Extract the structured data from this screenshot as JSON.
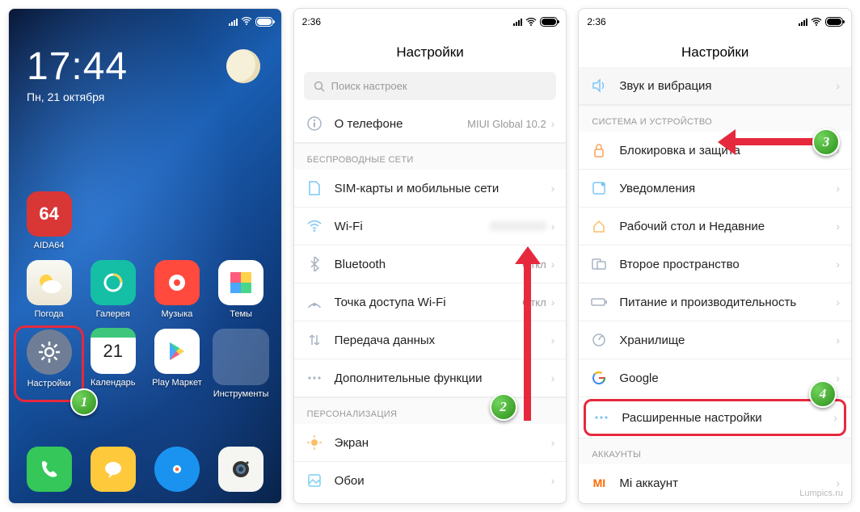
{
  "phone1": {
    "status_time": "",
    "clock_time": "17:44",
    "clock_date": "Пн, 21 октября",
    "apps": [
      {
        "label": "AIDA64",
        "bg": "#d93636",
        "text": "64"
      },
      {
        "label": "",
        "bg": "",
        "text": ""
      },
      {
        "label": "",
        "bg": "",
        "text": ""
      },
      {
        "label": "",
        "bg": "",
        "text": ""
      },
      {
        "label": "Погода",
        "bg": "linear-gradient(180deg,#f7f7f0,#e8e3d0)",
        "icon": "weather"
      },
      {
        "label": "Галерея",
        "bg": "#14bfa6",
        "icon": "gallery"
      },
      {
        "label": "Музыка",
        "bg": "#ff4a3d",
        "icon": "music"
      },
      {
        "label": "Темы",
        "bg": "#fff",
        "icon": "themes"
      },
      {
        "label": "Настройки",
        "bg": "#6f7e96",
        "icon": "gear",
        "highlight": true
      },
      {
        "label": "Календарь",
        "bg": "#fff",
        "text": "21",
        "icon": "calendar"
      },
      {
        "label": "Play Маркет",
        "bg": "#fff",
        "icon": "play"
      },
      {
        "label": "Инструменты",
        "bg": "rgba(255,255,255,0.18)",
        "icon": "folder"
      }
    ],
    "dock": [
      {
        "bg": "#35c759",
        "icon": "phone"
      },
      {
        "bg": "#ffc93c",
        "icon": "message"
      },
      {
        "bg": "#1a93f0",
        "icon": "browser"
      },
      {
        "bg": "#f5f5f2",
        "icon": "camera"
      }
    ]
  },
  "phone2": {
    "status_time": "2:36",
    "title": "Настройки",
    "search_placeholder": "Поиск настроек",
    "about_label": "О телефоне",
    "about_value": "MIUI Global 10.2",
    "section_wireless": "БЕСПРОВОДНЫЕ СЕТИ",
    "rows_wireless": [
      {
        "label": "SIM-карты и мобильные сети",
        "icon": "sim",
        "color": "#7ac6f6"
      },
      {
        "label": "Wi-Fi",
        "icon": "wifi",
        "color": "#7ac6f6",
        "value": ""
      },
      {
        "label": "Bluetooth",
        "icon": "bt",
        "color": "#a8b4c4",
        "value": "Откл"
      },
      {
        "label": "Точка доступа Wi-Fi",
        "icon": "hotspot",
        "color": "#a8b4c4",
        "value": "Откл"
      },
      {
        "label": "Передача данных",
        "icon": "data",
        "color": "#a8b4c4"
      },
      {
        "label": "Дополнительные функции",
        "icon": "more",
        "color": "#a8b4c4"
      }
    ],
    "section_personal": "ПЕРСОНАЛИЗАЦИЯ",
    "rows_personal": [
      {
        "label": "Экран",
        "icon": "display",
        "color": "#f9c06a"
      },
      {
        "label": "Обои",
        "icon": "wallpaper",
        "color": "#7dd0f0"
      }
    ]
  },
  "phone3": {
    "status_time": "2:36",
    "title": "Настройки",
    "sound_label": "Звук и вибрация",
    "section_system": "СИСТЕМА И УСТРОЙСТВО",
    "rows_system": [
      {
        "label": "Блокировка и защита",
        "icon": "lock",
        "color": "#f5a45a"
      },
      {
        "label": "Уведомления",
        "icon": "notif",
        "color": "#7ac6f6"
      },
      {
        "label": "Рабочий стол и Недавние",
        "icon": "desktop",
        "color": "#f9c06a"
      },
      {
        "label": "Второе пространство",
        "icon": "second",
        "color": "#a8b4c4"
      },
      {
        "label": "Питание и производительность",
        "icon": "battery",
        "color": "#a8b4c4"
      },
      {
        "label": "Хранилище",
        "icon": "storage",
        "color": "#a8b4c4"
      },
      {
        "label": "Google",
        "icon": "google",
        "color": ""
      },
      {
        "label": "Расширенные настройки",
        "icon": "more",
        "color": "#7ac6f6",
        "highlight": true
      }
    ],
    "section_accounts": "АККАУНТЫ",
    "rows_accounts": [
      {
        "label": "Mi аккаунт",
        "icon": "mi",
        "color": "#ff6a00"
      }
    ]
  },
  "watermark": "Lumpics.ru",
  "markers": {
    "m1": "1",
    "m2": "2",
    "m3": "3",
    "m4": "4"
  }
}
